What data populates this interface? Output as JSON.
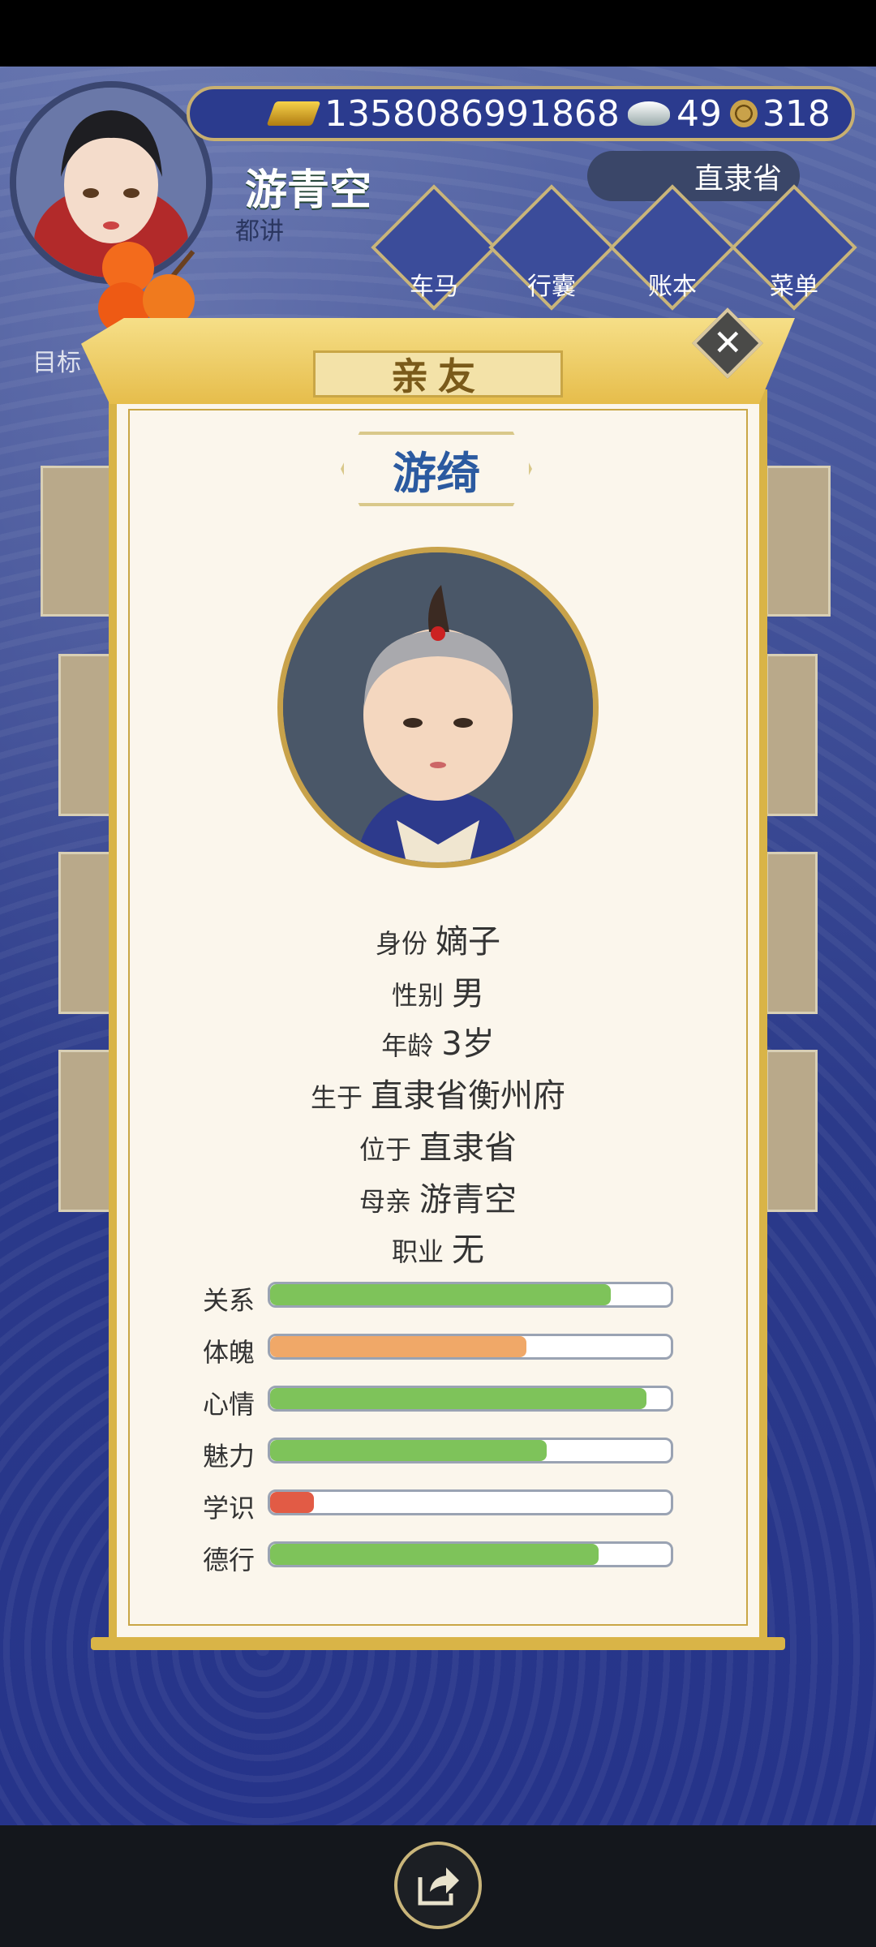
{
  "hud": {
    "gold": "1358086991868",
    "silver": "49",
    "coins": "318",
    "player_name": "游青空",
    "player_title": "都讲",
    "province": "直隶省",
    "nav": [
      {
        "label": "车马",
        "icon": "carriage-icon"
      },
      {
        "label": "行囊",
        "icon": "bag-icon"
      },
      {
        "label": "账本",
        "icon": "ledger-icon"
      },
      {
        "label": "菜单",
        "icon": "menu-icon"
      }
    ],
    "goal_label": "目标"
  },
  "modal": {
    "title": "亲友",
    "close_icon": "close-icon",
    "name": "游绮",
    "info": [
      {
        "key": "身份",
        "value": "嫡子"
      },
      {
        "key": "性别",
        "value": "男"
      },
      {
        "key": "年龄",
        "value": "3岁"
      },
      {
        "key": "生于",
        "value": "直隶省衡州府"
      },
      {
        "key": "位于",
        "value": "直隶省"
      },
      {
        "key": "母亲",
        "value": "游青空"
      },
      {
        "key": "职业",
        "value": "无"
      }
    ],
    "stats": [
      {
        "label": "关系",
        "percent": 85,
        "color": "#7ec35a"
      },
      {
        "label": "体魄",
        "percent": 64,
        "color": "#f0a868"
      },
      {
        "label": "心情",
        "percent": 94,
        "color": "#7ec35a"
      },
      {
        "label": "魅力",
        "percent": 69,
        "color": "#7ec35a"
      },
      {
        "label": "学识",
        "percent": 11,
        "color": "#e25b45"
      },
      {
        "label": "德行",
        "percent": 82,
        "color": "#7ec35a"
      }
    ]
  },
  "bottom": {
    "share_icon": "share-icon"
  }
}
